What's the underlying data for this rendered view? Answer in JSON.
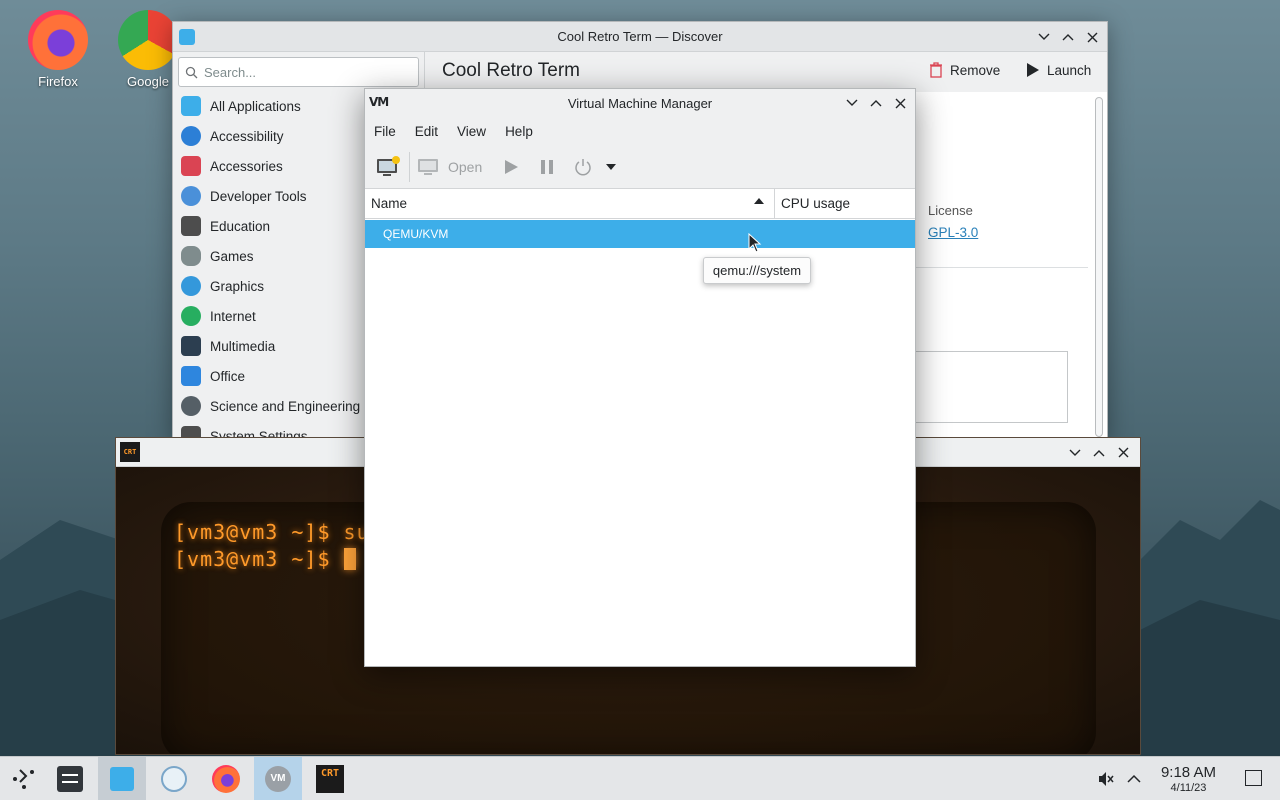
{
  "desktop": {
    "icons": [
      {
        "label": "Firefox"
      },
      {
        "label": "Google"
      }
    ]
  },
  "discover": {
    "title": "Cool Retro Term — Discover",
    "search_placeholder": "Search...",
    "categories": [
      {
        "label": "All Applications",
        "color": "#3daee9"
      },
      {
        "label": "Accessibility",
        "color": "#2c7fd6"
      },
      {
        "label": "Accessories",
        "color": "#da4453"
      },
      {
        "label": "Developer Tools",
        "color": "#4a90d9"
      },
      {
        "label": "Education",
        "color": "#4d4d4d"
      },
      {
        "label": "Games",
        "color": "#7f8c8d"
      },
      {
        "label": "Graphics",
        "color": "#3498db"
      },
      {
        "label": "Internet",
        "color": "#27ae60"
      },
      {
        "label": "Multimedia",
        "color": "#2c3e50"
      },
      {
        "label": "Office",
        "color": "#2e86de"
      },
      {
        "label": "Science and Engineering",
        "color": "#555f66"
      },
      {
        "label": "System Settings",
        "color": "#4d4d4d"
      }
    ],
    "app_name": "Cool Retro Term",
    "remove_label": "Remove",
    "launch_label": "Launch",
    "license_label": "License",
    "license_value": "GPL-3.0"
  },
  "terminal": {
    "badge": "CRT",
    "lines": [
      "[vm3@vm3 ~]$ su",
      "[vm3@vm3 ~]$ "
    ]
  },
  "vmm": {
    "title": "Virtual Machine Manager",
    "logo": "VM",
    "menu": [
      "File",
      "Edit",
      "View",
      "Help"
    ],
    "toolbar": {
      "open_label": "Open"
    },
    "columns": {
      "name": "Name",
      "cpu": "CPU usage"
    },
    "rows": [
      {
        "name": "QEMU/KVM"
      }
    ],
    "tooltip": "qemu:///system"
  },
  "taskbar": {
    "time": "9:18 AM",
    "date": "4/11/23",
    "crt_badge": "CRT",
    "vm_badge": "VM"
  },
  "colors": {
    "accent": "#3daee9",
    "crt_text": "#ff9a2a"
  }
}
